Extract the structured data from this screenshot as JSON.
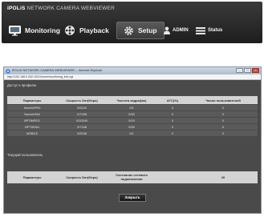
{
  "app": {
    "brand_prefix": "iPOLiS",
    "brand_name": "NETWORK CAMERA WEBVIEWER"
  },
  "nav": {
    "monitoring": "Monitoring",
    "playback": "Playback",
    "setup": "Setup",
    "admin": "ADMIN",
    "status": "Status"
  },
  "window": {
    "title": "iPOLiS NETWORK CAMERA WEBVIEWER -- Internet Explorer",
    "url": "http://192.168.0.252:1001/home/monitoring_info.cgi"
  },
  "profile_section": {
    "label": "Доступ к профилю",
    "columns": [
      "Параметры",
      "Скорость бит(Kbps)",
      "Частота кадра(fps)",
      "АТС(%)",
      "Число пользователей"
    ],
    "rows": [
      [
        "SaveAVPR0",
        "0/5120",
        "0/2",
        "0",
        "0"
      ],
      [
        "SaveaH264",
        "0/7168",
        "0/30",
        "0",
        "0"
      ],
      [
        "BPTIMPEG",
        "0/10240",
        "0/15",
        "0",
        "0"
      ],
      [
        "BPTIH264",
        "0/7168",
        "0/30",
        "0",
        "0"
      ],
      [
        "MOBILE",
        "0/2048",
        "0/1",
        "0",
        "0"
      ]
    ]
  },
  "current_section": {
    "label": "Текущий пользователь",
    "columns": [
      "Параметры",
      "Скорость бит(Kbps)",
      "Состояние сетевого подключения",
      "20"
    ]
  },
  "buttons": {
    "close": "Закрыть"
  },
  "colors": {
    "appbar": "#2b2b2b",
    "table_header": "#d3d3d3",
    "table_row": "#5a5a5a",
    "content_bg": "#4a4a4a",
    "titlebar": "#aebccd"
  }
}
